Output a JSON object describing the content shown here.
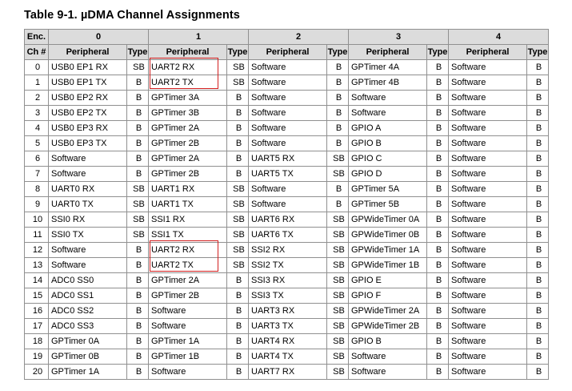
{
  "title": "Table 9-1. µDMA Channel Assignments",
  "header": {
    "enc_label": "Enc.",
    "ch_label": "Ch #",
    "encodings": [
      "0",
      "1",
      "2",
      "3",
      "4"
    ],
    "peripheral_label": "Peripheral",
    "type_label": "Type"
  },
  "rows": [
    {
      "ch": "0",
      "cells": [
        [
          "USB0 EP1 RX",
          "SB"
        ],
        [
          "UART2 RX",
          "SB"
        ],
        [
          "Software",
          "B"
        ],
        [
          "GPTimer 4A",
          "B"
        ],
        [
          "Software",
          "B"
        ]
      ]
    },
    {
      "ch": "1",
      "cells": [
        [
          "USB0 EP1 TX",
          "B"
        ],
        [
          "UART2 TX",
          "SB"
        ],
        [
          "Software",
          "B"
        ],
        [
          "GPTimer 4B",
          "B"
        ],
        [
          "Software",
          "B"
        ]
      ]
    },
    {
      "ch": "2",
      "cells": [
        [
          "USB0 EP2 RX",
          "B"
        ],
        [
          "GPTimer 3A",
          "B"
        ],
        [
          "Software",
          "B"
        ],
        [
          "Software",
          "B"
        ],
        [
          "Software",
          "B"
        ]
      ]
    },
    {
      "ch": "3",
      "cells": [
        [
          "USB0 EP2 TX",
          "B"
        ],
        [
          "GPTimer 3B",
          "B"
        ],
        [
          "Software",
          "B"
        ],
        [
          "Software",
          "B"
        ],
        [
          "Software",
          "B"
        ]
      ]
    },
    {
      "ch": "4",
      "cells": [
        [
          "USB0 EP3 RX",
          "B"
        ],
        [
          "GPTimer 2A",
          "B"
        ],
        [
          "Software",
          "B"
        ],
        [
          "GPIO A",
          "B"
        ],
        [
          "Software",
          "B"
        ]
      ]
    },
    {
      "ch": "5",
      "cells": [
        [
          "USB0 EP3 TX",
          "B"
        ],
        [
          "GPTimer 2B",
          "B"
        ],
        [
          "Software",
          "B"
        ],
        [
          "GPIO B",
          "B"
        ],
        [
          "Software",
          "B"
        ]
      ]
    },
    {
      "ch": "6",
      "cells": [
        [
          "Software",
          "B"
        ],
        [
          "GPTimer 2A",
          "B"
        ],
        [
          "UART5 RX",
          "SB"
        ],
        [
          "GPIO C",
          "B"
        ],
        [
          "Software",
          "B"
        ]
      ]
    },
    {
      "ch": "7",
      "cells": [
        [
          "Software",
          "B"
        ],
        [
          "GPTimer 2B",
          "B"
        ],
        [
          "UART5 TX",
          "SB"
        ],
        [
          "GPIO D",
          "B"
        ],
        [
          "Software",
          "B"
        ]
      ]
    },
    {
      "ch": "8",
      "cells": [
        [
          "UART0 RX",
          "SB"
        ],
        [
          "UART1 RX",
          "SB"
        ],
        [
          "Software",
          "B"
        ],
        [
          "GPTimer 5A",
          "B"
        ],
        [
          "Software",
          "B"
        ]
      ]
    },
    {
      "ch": "9",
      "cells": [
        [
          "UART0 TX",
          "SB"
        ],
        [
          "UART1 TX",
          "SB"
        ],
        [
          "Software",
          "B"
        ],
        [
          "GPTimer 5B",
          "B"
        ],
        [
          "Software",
          "B"
        ]
      ]
    },
    {
      "ch": "10",
      "cells": [
        [
          "SSI0 RX",
          "SB"
        ],
        [
          "SSI1 RX",
          "SB"
        ],
        [
          "UART6 RX",
          "SB"
        ],
        [
          "GPWideTimer 0A",
          "B"
        ],
        [
          "Software",
          "B"
        ]
      ]
    },
    {
      "ch": "11",
      "cells": [
        [
          "SSI0 TX",
          "SB"
        ],
        [
          "SSI1 TX",
          "SB"
        ],
        [
          "UART6 TX",
          "SB"
        ],
        [
          "GPWideTimer 0B",
          "B"
        ],
        [
          "Software",
          "B"
        ]
      ]
    },
    {
      "ch": "12",
      "cells": [
        [
          "Software",
          "B"
        ],
        [
          "UART2 RX",
          "SB"
        ],
        [
          "SSI2 RX",
          "SB"
        ],
        [
          "GPWideTimer 1A",
          "B"
        ],
        [
          "Software",
          "B"
        ]
      ]
    },
    {
      "ch": "13",
      "cells": [
        [
          "Software",
          "B"
        ],
        [
          "UART2 TX",
          "SB"
        ],
        [
          "SSI2 TX",
          "SB"
        ],
        [
          "GPWideTimer 1B",
          "B"
        ],
        [
          "Software",
          "B"
        ]
      ]
    },
    {
      "ch": "14",
      "cells": [
        [
          "ADC0 SS0",
          "B"
        ],
        [
          "GPTimer 2A",
          "B"
        ],
        [
          "SSI3 RX",
          "SB"
        ],
        [
          "GPIO E",
          "B"
        ],
        [
          "Software",
          "B"
        ]
      ]
    },
    {
      "ch": "15",
      "cells": [
        [
          "ADC0 SS1",
          "B"
        ],
        [
          "GPTimer 2B",
          "B"
        ],
        [
          "SSI3 TX",
          "SB"
        ],
        [
          "GPIO F",
          "B"
        ],
        [
          "Software",
          "B"
        ]
      ]
    },
    {
      "ch": "16",
      "cells": [
        [
          "ADC0 SS2",
          "B"
        ],
        [
          "Software",
          "B"
        ],
        [
          "UART3 RX",
          "SB"
        ],
        [
          "GPWideTimer 2A",
          "B"
        ],
        [
          "Software",
          "B"
        ]
      ]
    },
    {
      "ch": "17",
      "cells": [
        [
          "ADC0 SS3",
          "B"
        ],
        [
          "Software",
          "B"
        ],
        [
          "UART3 TX",
          "SB"
        ],
        [
          "GPWideTimer 2B",
          "B"
        ],
        [
          "Software",
          "B"
        ]
      ]
    },
    {
      "ch": "18",
      "cells": [
        [
          "GPTimer 0A",
          "B"
        ],
        [
          "GPTimer 1A",
          "B"
        ],
        [
          "UART4 RX",
          "SB"
        ],
        [
          "GPIO B",
          "B"
        ],
        [
          "Software",
          "B"
        ]
      ]
    },
    {
      "ch": "19",
      "cells": [
        [
          "GPTimer 0B",
          "B"
        ],
        [
          "GPTimer 1B",
          "B"
        ],
        [
          "UART4 TX",
          "SB"
        ],
        [
          "Software",
          "B"
        ],
        [
          "Software",
          "B"
        ]
      ]
    },
    {
      "ch": "20",
      "cells": [
        [
          "GPTimer 1A",
          "B"
        ],
        [
          "Software",
          "B"
        ],
        [
          "UART7 RX",
          "SB"
        ],
        [
          "Software",
          "B"
        ],
        [
          "Software",
          "B"
        ]
      ]
    }
  ],
  "highlights": [
    {
      "encoding": 1,
      "rows": [
        0,
        1
      ],
      "color": "#d21e1e"
    },
    {
      "encoding": 1,
      "rows": [
        12,
        13
      ],
      "color": "#d21e1e"
    }
  ]
}
